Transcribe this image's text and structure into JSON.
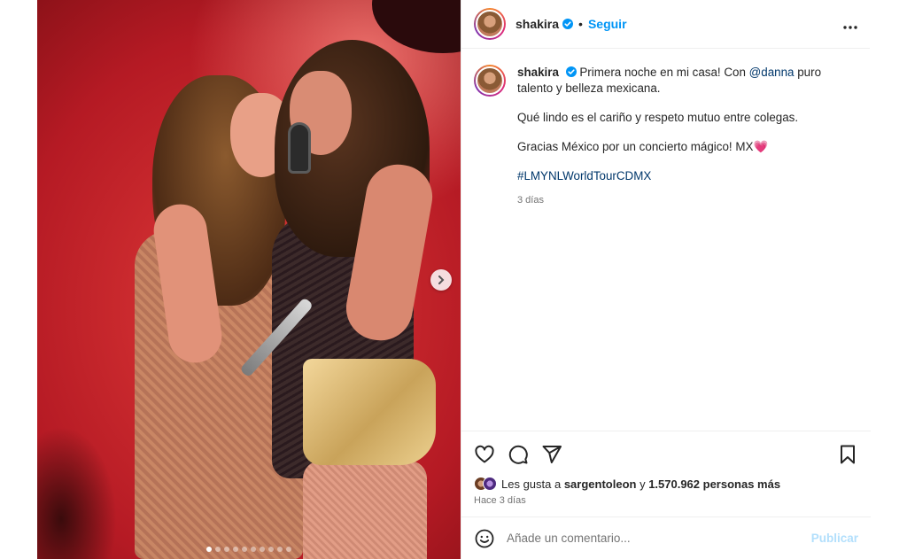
{
  "post": {
    "username": "shakira",
    "separator": "•",
    "follow_label": "Seguir",
    "more_label": "•••"
  },
  "caption": {
    "username": "shakira",
    "line1_prefix": "Primera noche en mi casa! Con ",
    "mention": "@danna",
    "line1_suffix": " puro talento y belleza mexicana.",
    "line2": "Qué lindo es el cariño y respeto mutuo entre colegas.",
    "line3": "Gracias México por un concierto mágico! MX",
    "heart": "💗",
    "hashtag": "#LMYNLWorldTourCDMX",
    "time": "3 días"
  },
  "likes": {
    "prefix": "Les gusta a ",
    "user": "sargentoleon",
    "middle": " y ",
    "count": "1.570.962 personas más"
  },
  "ago": "Hace 3 días",
  "comment": {
    "placeholder": "Añade un comentario...",
    "publish_label": "Publicar"
  },
  "carousel": {
    "slide_count": 10,
    "active_index": 0
  },
  "colors": {
    "accent": "#0095f6",
    "link": "#00376b",
    "verified": "#0095f6"
  }
}
